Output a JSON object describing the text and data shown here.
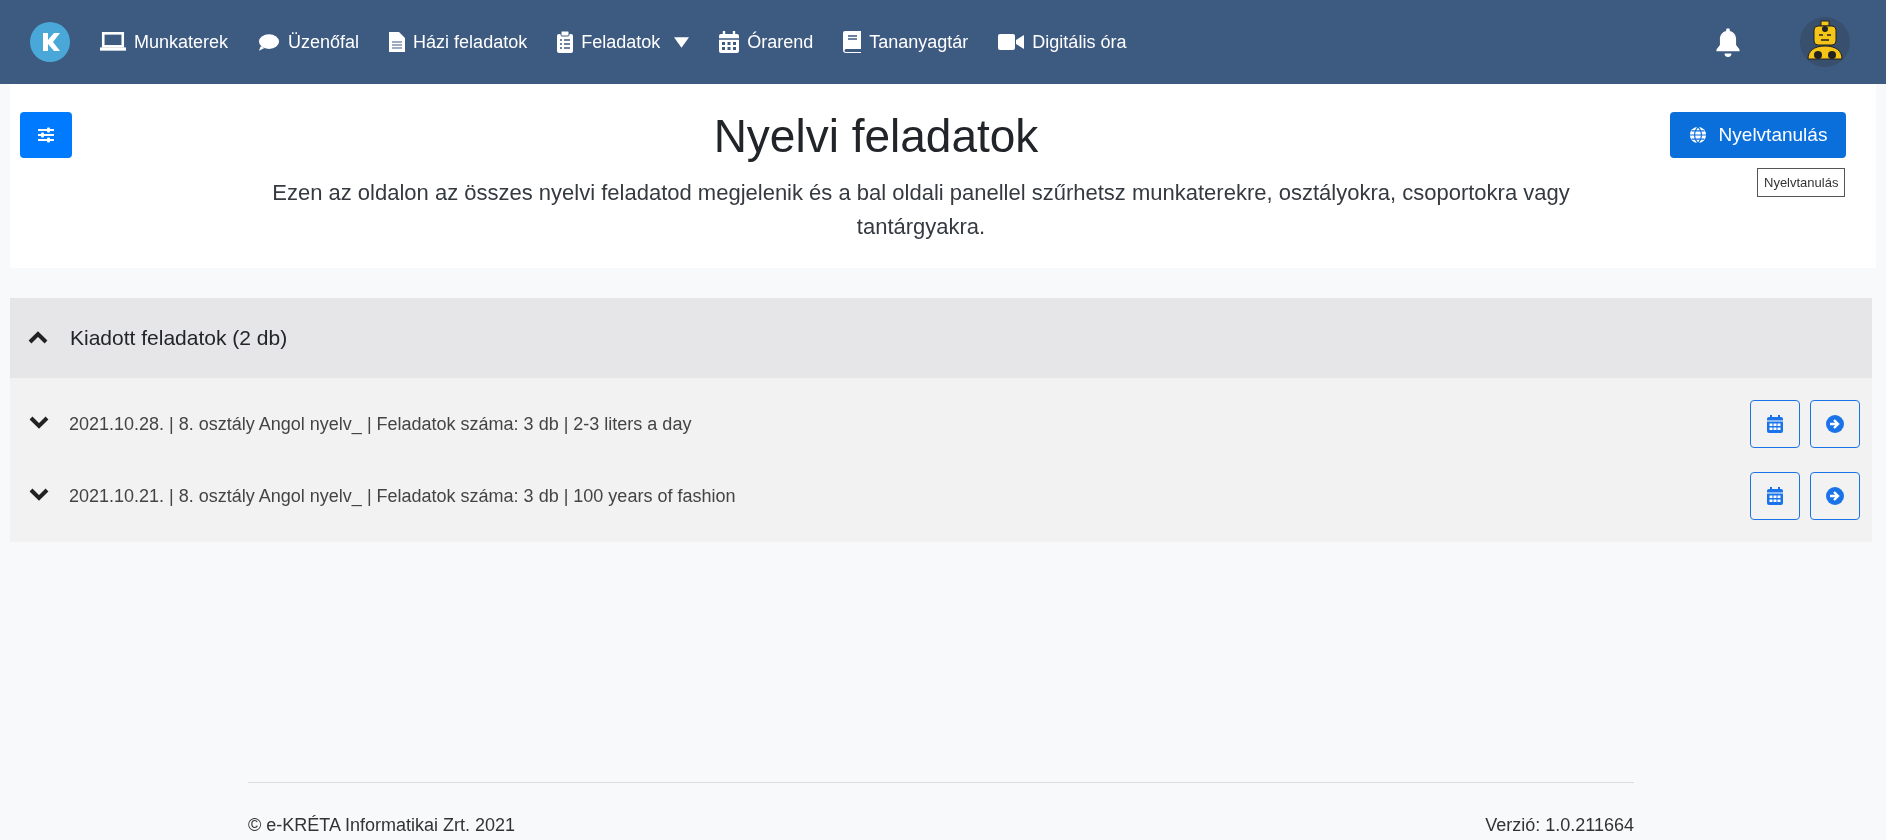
{
  "navbar": {
    "items": [
      {
        "label": "Munkaterek",
        "dropdown": false
      },
      {
        "label": "Üzenőfal",
        "dropdown": false
      },
      {
        "label": "Házi feladatok",
        "dropdown": false
      },
      {
        "label": "Feladatok",
        "dropdown": true
      },
      {
        "label": "Órarend",
        "dropdown": false
      },
      {
        "label": "Tananyagtár",
        "dropdown": false
      },
      {
        "label": "Digitális óra",
        "dropdown": false
      }
    ]
  },
  "header": {
    "title": "Nyelvi feladatok",
    "description": "Ezen az oldalon az összes nyelvi feladatod megjelenik és a bal oldali panellel szűrhetsz munkaterekre, osztályokra, csoportokra vagy tantárgyakra.",
    "button": "Nyelvtanulás",
    "tooltip": "Nyelvtanulás"
  },
  "section": {
    "title": "Kiadott feladatok (2 db)",
    "expanded": true,
    "rows": [
      {
        "text": "2021.10.28. | 8. osztály Angol nyelv_ | Feladatok száma: 3 db | 2-3 liters a day",
        "expanded": false
      },
      {
        "text": "2021.10.21. | 8. osztály Angol nyelv_ | Feladatok száma: 3 db | 100 years of fashion",
        "expanded": false
      }
    ]
  },
  "footer": {
    "copyright": "© e-KRÉTA Informatikai Zrt. 2021",
    "version": "Verzió: 1.0.211664"
  }
}
